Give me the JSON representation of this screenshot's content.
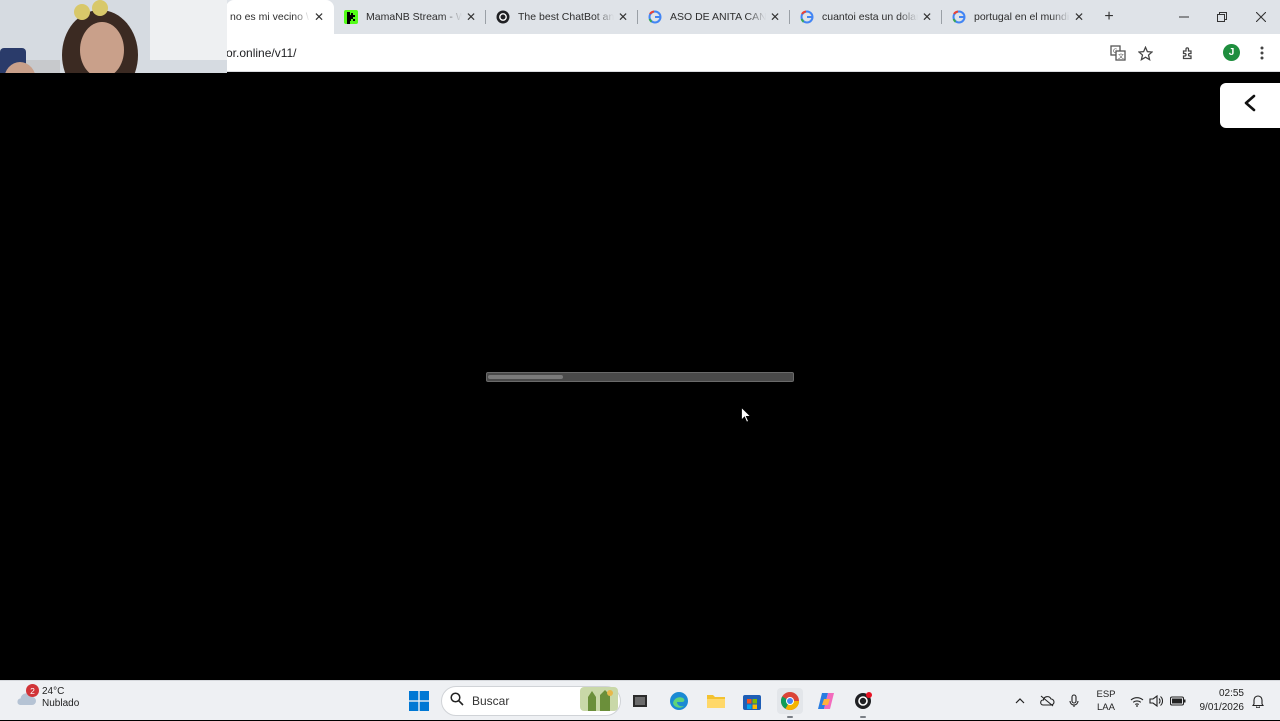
{
  "browser": {
    "tabs": [
      {
        "title": "no es mi vecino \\",
        "favicon": "tab-partial-icon",
        "active": true
      },
      {
        "title": "MamaNB Stream - W",
        "favicon": "kick-icon",
        "active": false
      },
      {
        "title": "The best ChatBot and",
        "favicon": "openai-icon",
        "active": false
      },
      {
        "title": "ASO DE ANITA CANC",
        "favicon": "google-icon",
        "active": false
      },
      {
        "title": "cuantoi esta un dolar",
        "favicon": "google-icon",
        "active": false
      },
      {
        "title": "portugal en el mundi",
        "favicon": "google-icon",
        "active": false
      }
    ],
    "url": "or.online/v11/",
    "profile_initial": "J"
  },
  "page": {
    "loading_progress_percent": 25,
    "back_icon": "chevron-left-icon"
  },
  "taskbar": {
    "weather": {
      "temperature": "24°C",
      "condition": "Nublado",
      "badge": "2"
    },
    "search_placeholder": "Buscar",
    "language": {
      "top": "ESP",
      "bottom": "LAA"
    },
    "clock": {
      "time": "02:55",
      "date": "9/01/2026"
    }
  },
  "colors": {
    "accent_green": "#1e8e3e",
    "windows_blue": "#0078d4",
    "page_background": "#000000"
  }
}
